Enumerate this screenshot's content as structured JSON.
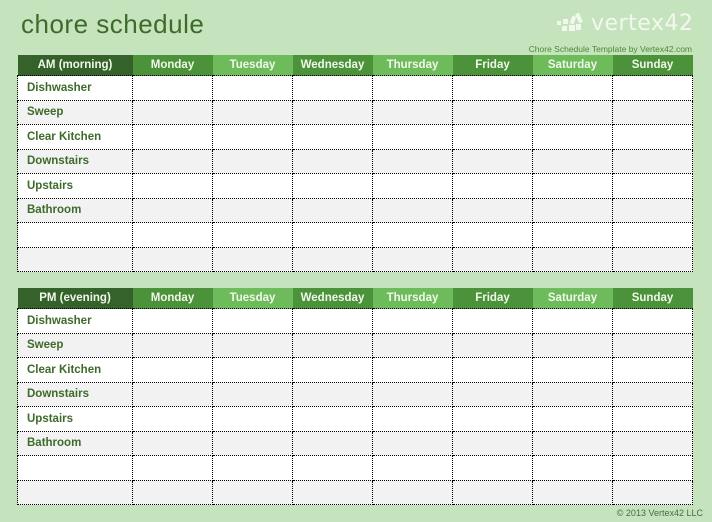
{
  "title": "chore schedule",
  "brand": {
    "logo_text": "vertex42",
    "logo_icon": "vertex42-logo-icon",
    "subtitle": "Chore Schedule Template by Vertex42.com"
  },
  "days": [
    "Monday",
    "Tuesday",
    "Wednesday",
    "Thursday",
    "Friday",
    "Saturday",
    "Sunday"
  ],
  "tables": [
    {
      "header": "AM (morning)",
      "chores": [
        "Dishwasher",
        "Sweep",
        "Clear Kitchen",
        "Downstairs",
        "Upstairs",
        "Bathroom",
        "",
        ""
      ]
    },
    {
      "header": "PM (evening)",
      "chores": [
        "Dishwasher",
        "Sweep",
        "Clear Kitchen",
        "Downstairs",
        "Upstairs",
        "Bathroom",
        "",
        ""
      ]
    }
  ],
  "colors": {
    "background": "#c5e3bc",
    "header_dark": "#34622a",
    "header_mid": "#4b923a",
    "header_light": "#6dbb5a",
    "text_green": "#3d6b2a"
  },
  "footer": {
    "copyright": "© 2013 Vertex42 LLC"
  }
}
